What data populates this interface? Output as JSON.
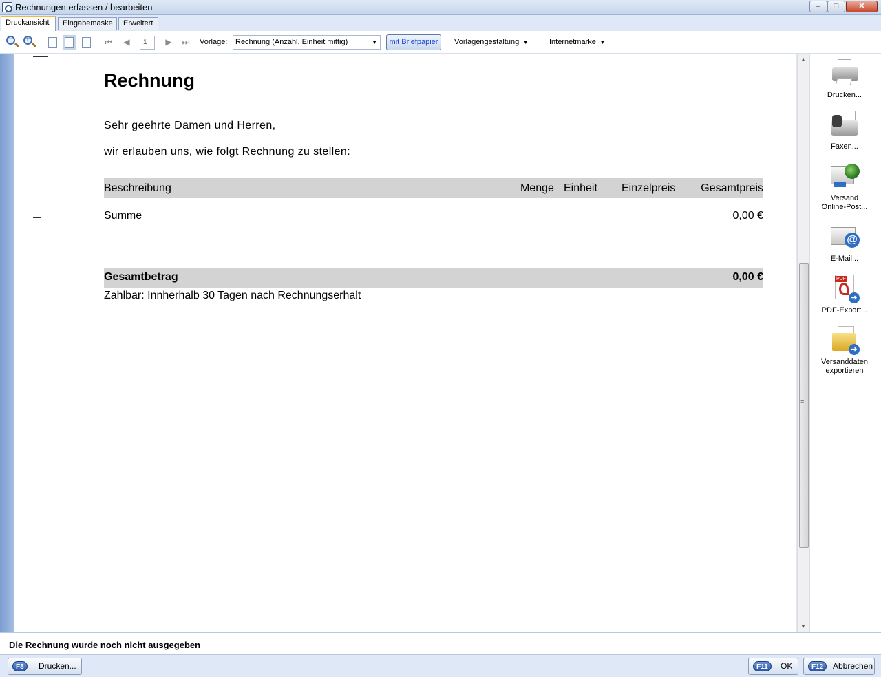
{
  "window": {
    "title": "Rechnungen erfassen / bearbeiten",
    "controls": {
      "minimize": "–",
      "maximize": "□",
      "close": "✕"
    }
  },
  "tabs": [
    {
      "label": "Druckansicht",
      "active": true
    },
    {
      "label": "Eingabemaske",
      "active": false
    },
    {
      "label": "Erweitert",
      "active": false
    }
  ],
  "toolbar": {
    "page_number": "1",
    "template_label": "Vorlage:",
    "template_value": "Rechnung (Anzahl, Einheit mittig)",
    "letterhead_button": "mit Briefpapier",
    "template_design_menu": "Vorlagengestaltung",
    "postage_menu": "Internetmarke",
    "icons": [
      "zoom-out-icon",
      "zoom-in-icon",
      "single-page-icon",
      "page-width-icon",
      "full-page-icon",
      "first-page-icon",
      "previous-page-icon",
      "next-page-icon",
      "last-page-icon"
    ]
  },
  "document": {
    "title": "Rechnung",
    "salutation": "Sehr geehrte Damen und Herren,",
    "intro": "wir erlauben uns, wie folgt Rechnung zu stellen:",
    "table_headers": {
      "description": "Beschreibung",
      "quantity": "Menge",
      "unit": "Einheit",
      "unit_price": "Einzelpreis",
      "total_price": "Gesamtpreis"
    },
    "sum_label": "Summe",
    "sum_value": "0,00 €",
    "total_label": "Gesamtbetrag",
    "total_value": "0,00 €",
    "payment_terms": "Zahlbar: Innherhalb 30 Tagen nach Rechnungserhalt"
  },
  "side_actions": [
    {
      "label_line1": "Drucken...",
      "label_line2": "",
      "icon": "printer-icon"
    },
    {
      "label_line1": "Faxen...",
      "label_line2": "",
      "icon": "fax-icon"
    },
    {
      "label_line1": "Versand",
      "label_line2": "Online-Post...",
      "icon": "online-post-icon"
    },
    {
      "label_line1": "E-Mail...",
      "label_line2": "",
      "icon": "email-icon"
    },
    {
      "label_line1": "PDF-Export...",
      "label_line2": "",
      "icon": "pdf-export-icon"
    },
    {
      "label_line1": "Versanddaten",
      "label_line2": "exportieren",
      "icon": "shipping-export-icon"
    }
  ],
  "status": {
    "message": "Die Rechnung wurde noch nicht ausgegeben"
  },
  "buttons": {
    "print": {
      "key": "F8",
      "label": "Drucken..."
    },
    "ok": {
      "key": "F11",
      "label": "OK"
    },
    "cancel": {
      "key": "F12",
      "label": "Abbrechen"
    }
  },
  "colors": {
    "accent": "#2a57a6",
    "link": "#1a3fd0",
    "table_header_bg": "#d3d3d3",
    "window_bg": "#dfe8f6"
  }
}
